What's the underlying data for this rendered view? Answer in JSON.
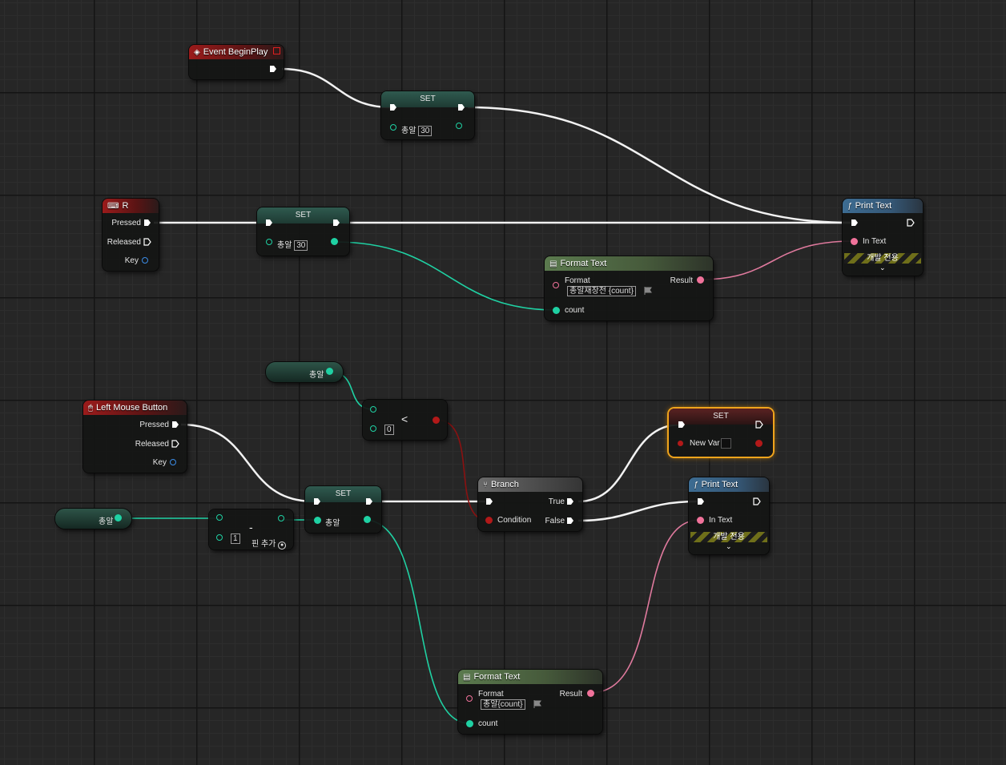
{
  "event_begin_play": {
    "title": "Event BeginPlay"
  },
  "set_nodes": {
    "set1": {
      "title": "SET",
      "var": "총알",
      "value": "30"
    },
    "set2": {
      "title": "SET",
      "var": "총알",
      "value": "30"
    },
    "set3": {
      "title": "SET",
      "var": "총알"
    },
    "set4": {
      "title": "SET",
      "var": "New Var"
    }
  },
  "r_key": {
    "title": "R",
    "pressed": "Pressed",
    "released": "Released",
    "key": "Key"
  },
  "lmb": {
    "title": "Left Mouse Button",
    "pressed": "Pressed",
    "released": "Released",
    "key": "Key"
  },
  "print1": {
    "title": "Print Text",
    "in_text": "In Text",
    "dev_only": "개발 전용"
  },
  "print2": {
    "title": "Print Text",
    "in_text": "In Text",
    "dev_only": "개발 전용"
  },
  "format1": {
    "title": "Format Text",
    "format": "Format",
    "format_value": "총알재장전 {count}",
    "result": "Result",
    "count": "count"
  },
  "format2": {
    "title": "Format Text",
    "format": "Format",
    "format_value": "총알{count}",
    "result": "Result",
    "count": "count"
  },
  "getter1": {
    "label": "총알"
  },
  "getter2": {
    "label": "총알"
  },
  "less": {
    "op": "<",
    "value": "0"
  },
  "minus": {
    "op": "-",
    "value": "1",
    "add_pin": "핀 추가"
  },
  "branch": {
    "title": "Branch",
    "true": "True",
    "false": "False",
    "condition": "Condition"
  },
  "colors": {
    "exec": "#ffffff",
    "int": "#1fd1a3",
    "text": "#f0729a",
    "bool": "#b21919",
    "select": "#f0a41c"
  },
  "icons": {
    "event": "event-diamond-icon",
    "key": "keyboard-icon",
    "mouse": "mouse-icon",
    "function": "function-icon",
    "format": "format-text-icon",
    "branch": "branch-icon",
    "flag": "flag-icon"
  }
}
